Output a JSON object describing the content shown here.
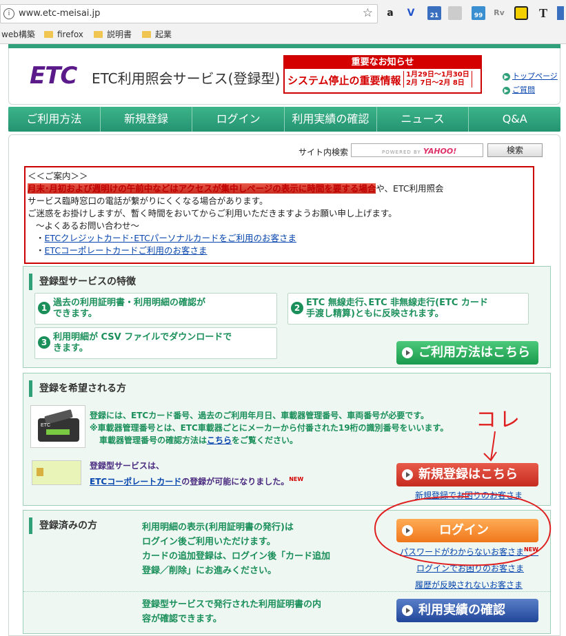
{
  "browser": {
    "url": "www.etc-meisai.jp",
    "extensions": [
      "a",
      "V",
      "21",
      "",
      "99",
      "Rv",
      "",
      "T"
    ],
    "bookmarks": [
      "web構築",
      "firefox",
      "説明書",
      "起業"
    ]
  },
  "header": {
    "logo": "ETC",
    "site_title": "ETC利用照会サービス(登録型)",
    "notice_title": "重要なお知らせ",
    "notice_main": "システム停止の重要情報",
    "notice_date1": "1月29日〜1月30日",
    "notice_date2": "2月 7日〜2月 8日",
    "link_top": "トップページ",
    "link_help": "ご質問"
  },
  "nav": {
    "items": [
      "ご利用方法",
      "新規登録",
      "ログイン",
      "利用実績の確認",
      "ニュース",
      "Q&A"
    ]
  },
  "search": {
    "label": "サイト内検索",
    "powered": "POWERED BY",
    "brand": "YAHOO!",
    "button": "検索"
  },
  "guide": {
    "heading": "＜＜ご案内＞＞",
    "red_text": "月末･月初および週明けの午前中などはアクセスが集中しページの表示に時間を要する場合",
    "line1_rest": "や、ETC利用照会",
    "line2": "サービス臨時窓口の電話が繋がりにくくなる場合があります。",
    "line3": "ご迷惑をお掛けしますが、暫く時間をおいてからご利用いただきますようお願い申し上げます。",
    "line4": "〜よくあるお問い合わせ〜",
    "link1": "ETCクレジットカード･ETCパーソナルカードをご利用のお客さま",
    "link2": "ETCコーポレートカードご利用のお客さま"
  },
  "features": {
    "title": "登録型サービスの特徴",
    "items": [
      {
        "num": "1",
        "text": "過去の利用証明書・利用明細の確認が\nできます。"
      },
      {
        "num": "2",
        "text": "ETC 無線走行､ETC 非無線走行(ETC カード\n手渡し精算)ともに反映されます。"
      },
      {
        "num": "3",
        "text": "利用明細が CSV ファイルでダウンロードで\nきます。"
      }
    ],
    "button": "ご利用方法はこちら"
  },
  "register": {
    "title": "登録を希望される方",
    "text1": "登録には、ETCカード番号、過去のご利用年月日、車載器管理番号、車両番号が必要です。",
    "text2": "※車載器管理番号とは、ETC車載器ごとにメーカーから付番された19桁の識別番号をいいます。",
    "text3_a": "車載器管理番号の確認方法は",
    "text3_link": "こちら",
    "text3_b": "をご覧ください。",
    "corp1": "登録型サービスは、",
    "corp_link": "ETCコーポレートカード",
    "corp2": "の登録が可能になりました。",
    "new": "NEW",
    "button": "新規登録はこちら",
    "help_link": "新規登録でお困りのお客さま"
  },
  "registered": {
    "title": "登録済みの方",
    "text1": "利用明細の表示(利用証明書の発行)は",
    "text2": "ログイン後ご利用いただけます。",
    "text3": "カードの追加登録は、ログイン後「カード追加",
    "text4": "登録／削除」にお進みください。",
    "login_button": "ログイン",
    "link1": "パスワードがわからないお客さま",
    "new": "NEW",
    "link2": "ログインでお困りのお客さま",
    "link3": "履歴が反映されないお客さま",
    "text5": "登録型サービスで発行された利用証明書の内",
    "text6": "容が確認できます。",
    "history_button": "利用実績の確認"
  },
  "annotation": {
    "text": "コレ"
  }
}
